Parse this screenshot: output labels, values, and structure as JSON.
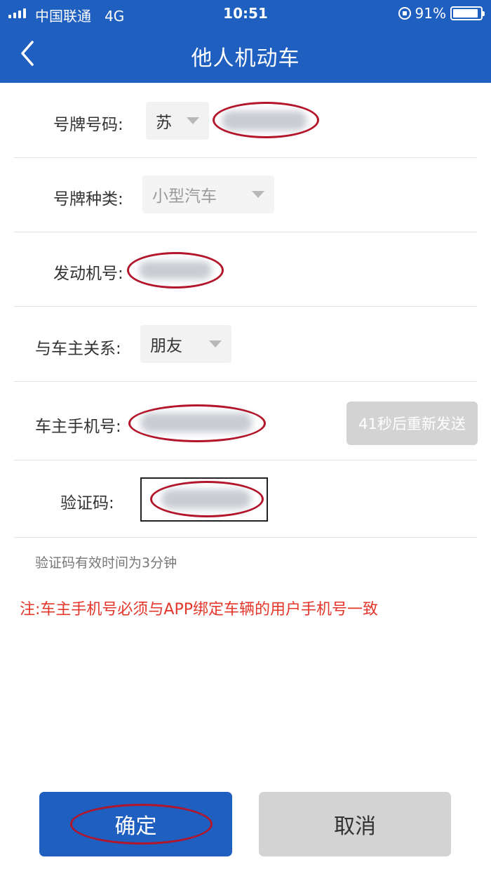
{
  "status_bar": {
    "carrier": "中国联通",
    "network": "4G",
    "time": "10:51",
    "battery": "91%",
    "battery_level": 0.91
  },
  "nav": {
    "title": "他人机动车",
    "back_icon": "chevron-left-icon"
  },
  "form": {
    "plate_number": {
      "label": "号牌号码:",
      "province": "苏"
    },
    "plate_type": {
      "label": "号牌种类:",
      "value": "小型汽车"
    },
    "engine_number": {
      "label": "发动机号:"
    },
    "relation": {
      "label": "与车主关系:",
      "value": "朋友"
    },
    "owner_phone": {
      "label": "车主手机号:",
      "resend_label": "41秒后重新发送"
    },
    "verify_code": {
      "label": "验证码:"
    }
  },
  "hint": "验证码有效时间为3分钟",
  "note": "注:车主手机号必须与APP绑定车辆的用户手机号一致",
  "buttons": {
    "confirm": "确定",
    "cancel": "取消"
  },
  "colors": {
    "primary": "#1f5fbf",
    "note_red": "#e4362a",
    "annotation_oval": "#b3162a",
    "disabled_button": "#d3d3d3"
  }
}
